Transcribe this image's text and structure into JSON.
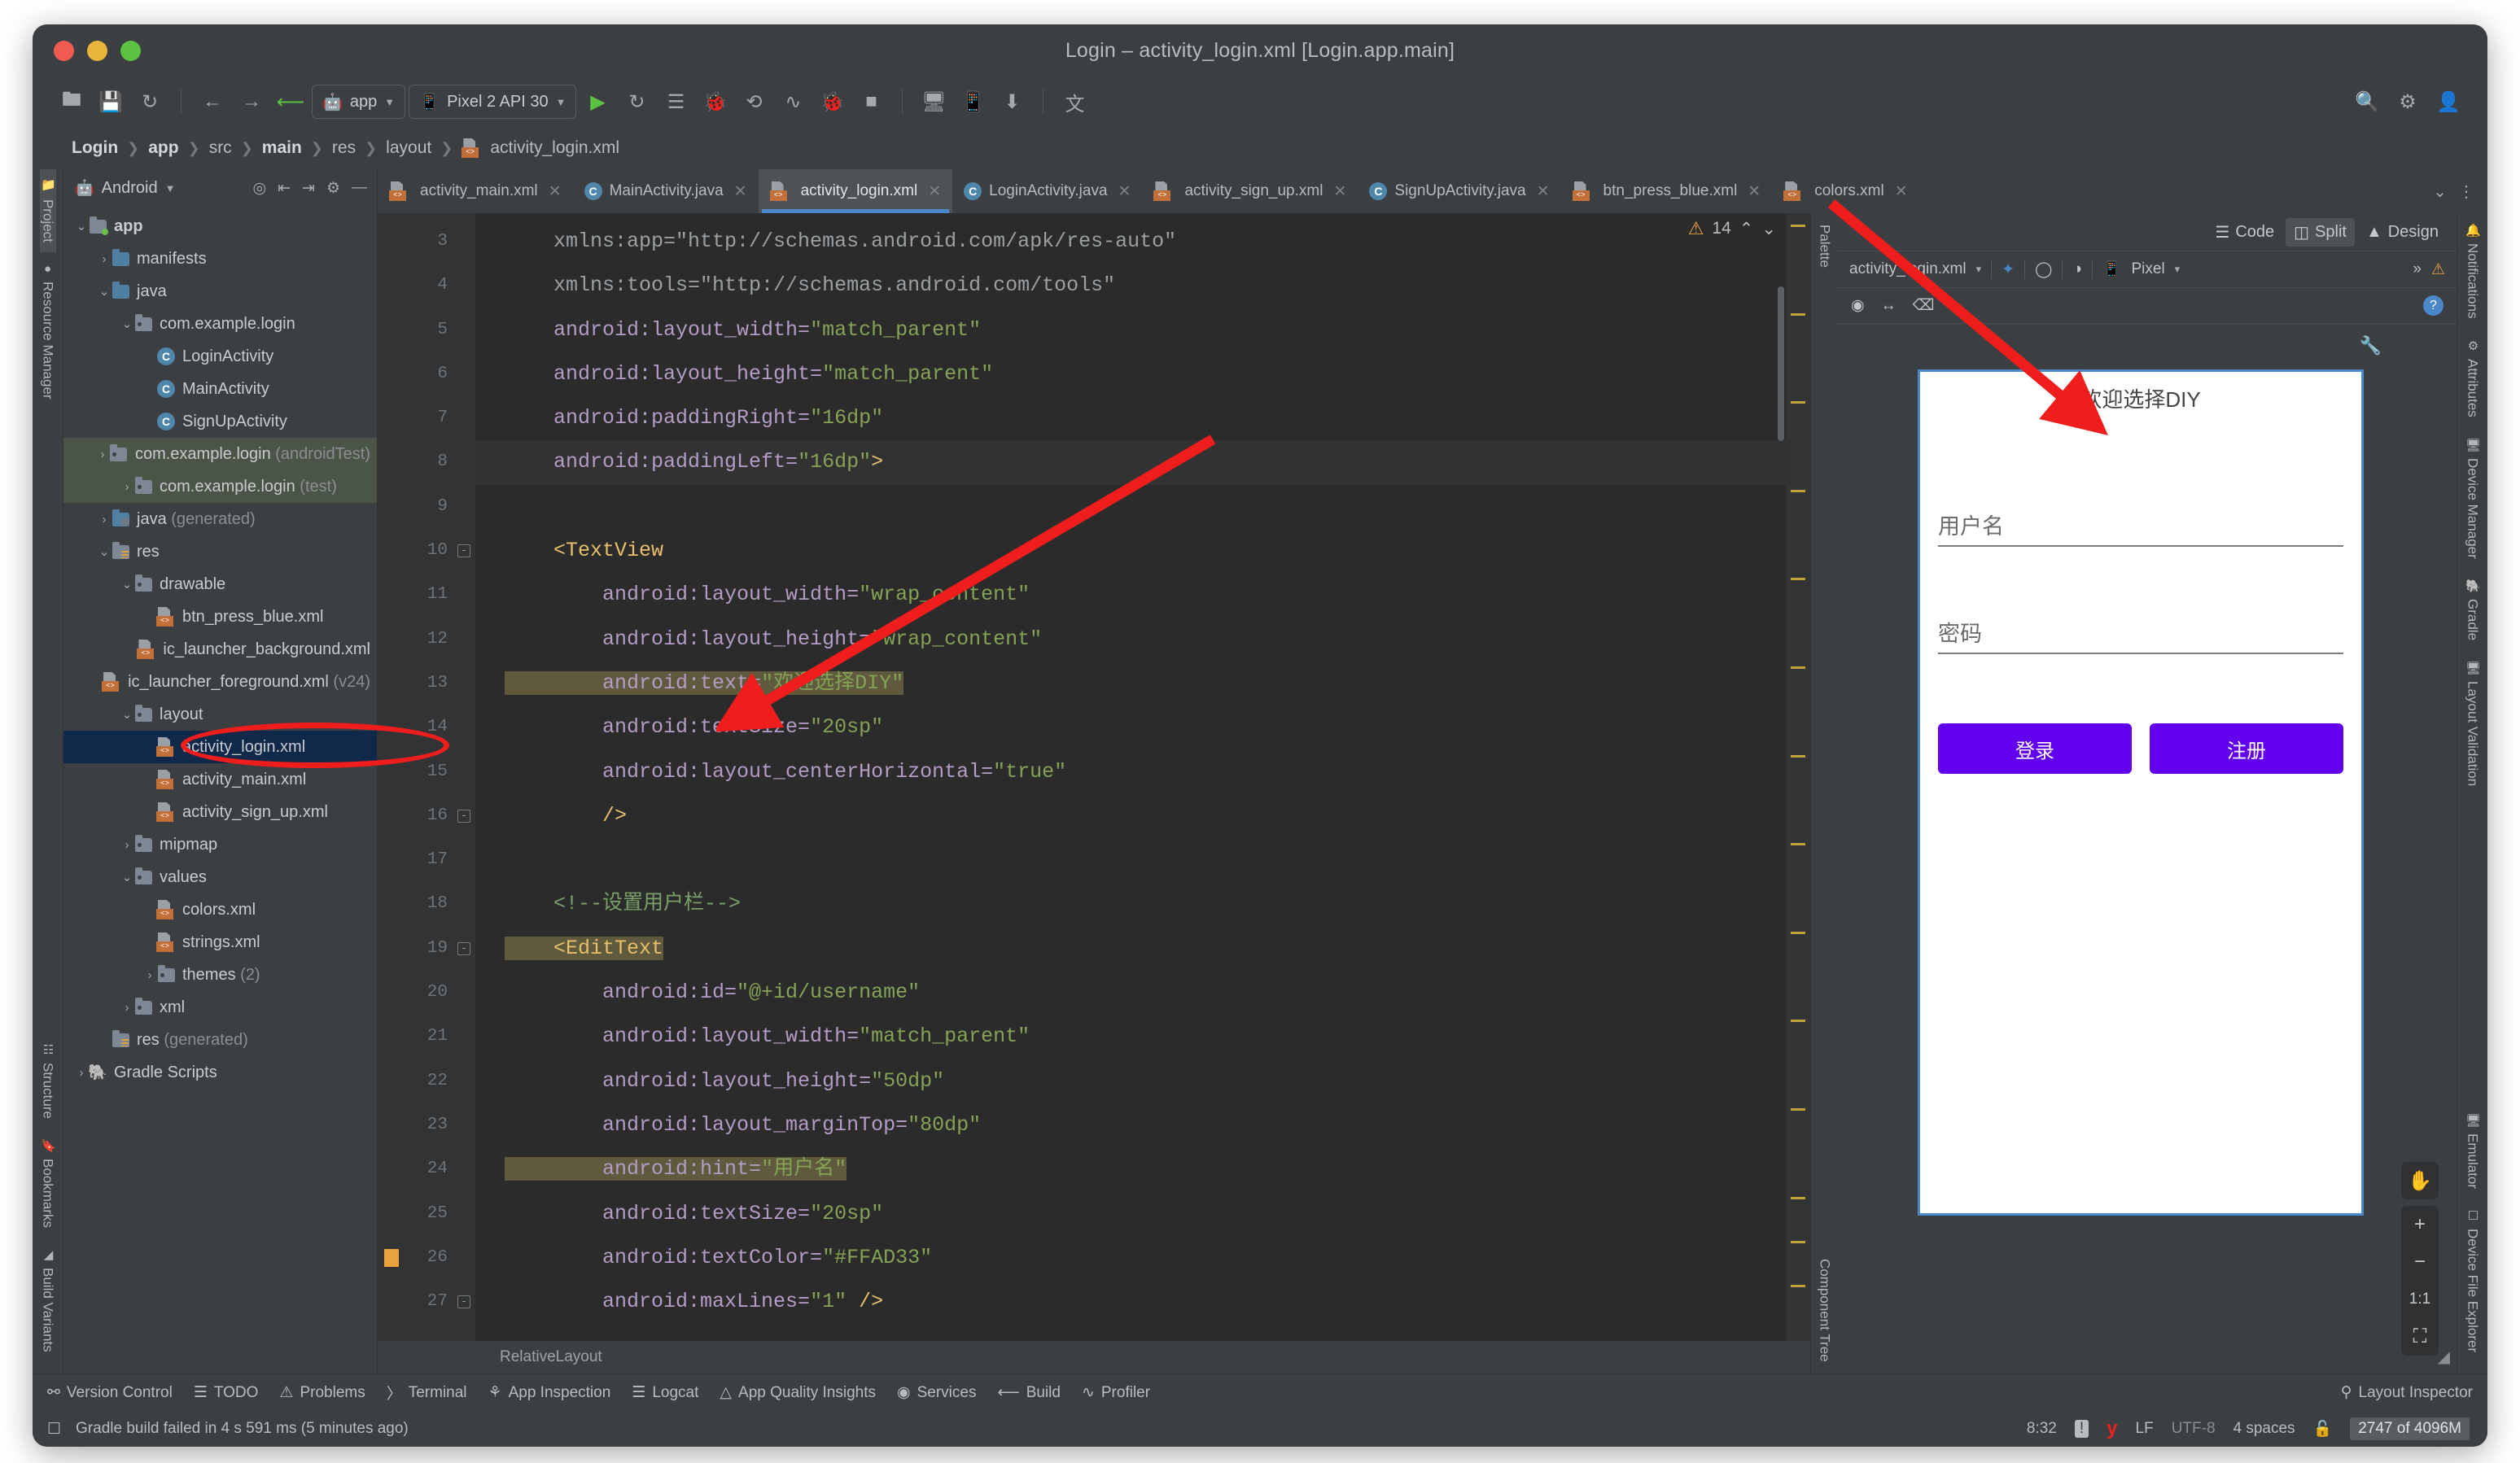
{
  "window": {
    "title": "Login – activity_login.xml [Login.app.main]",
    "traffic": {
      "close": "close-button",
      "minimize": "minimize-button",
      "zoom": "zoom-button"
    }
  },
  "toolbar": {
    "module_chip": "app",
    "device_chip": "Pixel 2 API 30",
    "icons": [
      "open-folder",
      "save",
      "sync",
      "back",
      "forward",
      "build-hammer",
      "run",
      "rerun",
      "more-run",
      "debug",
      "step",
      "profile",
      "attach-debugger",
      "stop",
      "avd-manager",
      "sdk-manager",
      "download",
      "translate"
    ],
    "right_icons": [
      "search",
      "settings",
      "account"
    ]
  },
  "breadcrumbs": [
    {
      "label": "Login",
      "bold": true
    },
    {
      "label": "app",
      "bold": true
    },
    {
      "label": "src",
      "bold": false
    },
    {
      "label": "main",
      "bold": true
    },
    {
      "label": "res",
      "bold": false
    },
    {
      "label": "layout",
      "bold": false
    },
    {
      "label": "activity_login.xml",
      "bold": false,
      "icon": "xml-file-icon"
    }
  ],
  "left_rail": {
    "top": [
      "Project",
      "Resource Manager"
    ],
    "bottom": [
      "Build Variants",
      "Bookmarks",
      "Structure"
    ]
  },
  "right_rail": {
    "top": [
      "Notifications",
      "Device Manager",
      "Gradle",
      "Layout Validation"
    ],
    "bottom": [
      "Device File Explorer",
      "Emulator"
    ]
  },
  "project": {
    "header": "Android",
    "header_icon": "android-icon",
    "tool_icons": [
      "locate-icon",
      "expand-all-icon",
      "collapse-all-icon",
      "gear-icon",
      "hide-icon"
    ],
    "tree": [
      {
        "indent": 0,
        "arrow": "down",
        "icon": "module-folder",
        "label": "app",
        "bold": true,
        "suffix": "",
        "state": ""
      },
      {
        "indent": 1,
        "arrow": "right",
        "icon": "folder-blue",
        "label": "manifests",
        "bold": false,
        "suffix": "",
        "state": ""
      },
      {
        "indent": 1,
        "arrow": "down",
        "icon": "folder-blue",
        "label": "java",
        "bold": false,
        "suffix": "",
        "state": ""
      },
      {
        "indent": 2,
        "arrow": "down",
        "icon": "package",
        "label": "com.example.login",
        "bold": false,
        "suffix": "",
        "state": ""
      },
      {
        "indent": 3,
        "arrow": "none",
        "icon": "class",
        "label": "LoginActivity",
        "bold": false,
        "suffix": "",
        "state": ""
      },
      {
        "indent": 3,
        "arrow": "none",
        "icon": "class",
        "label": "MainActivity",
        "bold": false,
        "suffix": "",
        "state": ""
      },
      {
        "indent": 3,
        "arrow": "none",
        "icon": "class",
        "label": "SignUpActivity",
        "bold": false,
        "suffix": "",
        "state": ""
      },
      {
        "indent": 2,
        "arrow": "right",
        "icon": "package",
        "label": "com.example.login",
        "bold": false,
        "suffix": "(androidTest)",
        "state": "sel-green"
      },
      {
        "indent": 2,
        "arrow": "right",
        "icon": "package",
        "label": "com.example.login",
        "bold": false,
        "suffix": "(test)",
        "state": "sel-green"
      },
      {
        "indent": 1,
        "arrow": "right",
        "icon": "folder-gen",
        "label": "java",
        "bold": false,
        "suffix": "(generated)",
        "state": ""
      },
      {
        "indent": 1,
        "arrow": "down",
        "icon": "folder-res",
        "label": "res",
        "bold": false,
        "suffix": "",
        "state": ""
      },
      {
        "indent": 2,
        "arrow": "down",
        "icon": "package",
        "label": "drawable",
        "bold": false,
        "suffix": "",
        "state": ""
      },
      {
        "indent": 3,
        "arrow": "none",
        "icon": "xml-file",
        "label": "btn_press_blue.xml",
        "bold": false,
        "suffix": "",
        "state": ""
      },
      {
        "indent": 3,
        "arrow": "none",
        "icon": "xml-file",
        "label": "ic_launcher_background.xml",
        "bold": false,
        "suffix": "",
        "state": ""
      },
      {
        "indent": 3,
        "arrow": "none",
        "icon": "xml-file",
        "label": "ic_launcher_foreground.xml",
        "bold": false,
        "suffix": "(v24)",
        "state": ""
      },
      {
        "indent": 2,
        "arrow": "down",
        "icon": "package",
        "label": "layout",
        "bold": false,
        "suffix": "",
        "state": ""
      },
      {
        "indent": 3,
        "arrow": "none",
        "icon": "xml-file",
        "label": "activity_login.xml",
        "bold": false,
        "suffix": "",
        "state": "sel-blue"
      },
      {
        "indent": 3,
        "arrow": "none",
        "icon": "xml-file",
        "label": "activity_main.xml",
        "bold": false,
        "suffix": "",
        "state": ""
      },
      {
        "indent": 3,
        "arrow": "none",
        "icon": "xml-file",
        "label": "activity_sign_up.xml",
        "bold": false,
        "suffix": "",
        "state": ""
      },
      {
        "indent": 2,
        "arrow": "right",
        "icon": "package",
        "label": "mipmap",
        "bold": false,
        "suffix": "",
        "state": ""
      },
      {
        "indent": 2,
        "arrow": "down",
        "icon": "package",
        "label": "values",
        "bold": false,
        "suffix": "",
        "state": ""
      },
      {
        "indent": 3,
        "arrow": "none",
        "icon": "xml-file",
        "label": "colors.xml",
        "bold": false,
        "suffix": "",
        "state": ""
      },
      {
        "indent": 3,
        "arrow": "none",
        "icon": "xml-file",
        "label": "strings.xml",
        "bold": false,
        "suffix": "",
        "state": ""
      },
      {
        "indent": 3,
        "arrow": "right",
        "icon": "package",
        "label": "themes",
        "bold": false,
        "suffix": "(2)",
        "state": ""
      },
      {
        "indent": 2,
        "arrow": "right",
        "icon": "package",
        "label": "xml",
        "bold": false,
        "suffix": "",
        "state": ""
      },
      {
        "indent": 1,
        "arrow": "none",
        "icon": "folder-res",
        "label": "res",
        "bold": false,
        "suffix": "(generated)",
        "state": ""
      },
      {
        "indent": 0,
        "arrow": "right",
        "icon": "gradle",
        "label": "Gradle Scripts",
        "bold": false,
        "suffix": "",
        "state": ""
      }
    ]
  },
  "tabs": [
    {
      "label": "activity_main.xml",
      "icon": "xml-file",
      "active": false
    },
    {
      "label": "MainActivity.java",
      "icon": "class",
      "active": false
    },
    {
      "label": "activity_login.xml",
      "icon": "xml-file",
      "active": true
    },
    {
      "label": "LoginActivity.java",
      "icon": "class",
      "active": false
    },
    {
      "label": "activity_sign_up.xml",
      "icon": "xml-file",
      "active": false
    },
    {
      "label": "SignUpActivity.java",
      "icon": "class",
      "active": false
    },
    {
      "label": "btn_press_blue.xml",
      "icon": "xml-file",
      "active": false
    },
    {
      "label": "colors.xml",
      "icon": "xml-file",
      "active": false
    }
  ],
  "editor": {
    "inspection_count": "14",
    "component_crumb": "RelativeLayout",
    "lines": [
      {
        "n": "3",
        "cut": true,
        "cursor": false,
        "fold": "",
        "warn": false,
        "spans": [
          {
            "t": "    xmlns:app=\"http://schemas.android.com/apk/res-auto\"",
            "c": "ns"
          }
        ]
      },
      {
        "n": "4",
        "cut": false,
        "cursor": false,
        "fold": "",
        "warn": false,
        "spans": [
          {
            "t": "    xmlns:tools=\"http://schemas.android.com/tools\"",
            "c": "ns"
          }
        ]
      },
      {
        "n": "5",
        "cut": false,
        "cursor": false,
        "fold": "",
        "warn": false,
        "spans": [
          {
            "t": "    android:layout_width=",
            "c": "attr"
          },
          {
            "t": "\"match_parent\"",
            "c": "val"
          }
        ]
      },
      {
        "n": "6",
        "cut": false,
        "cursor": false,
        "fold": "",
        "warn": false,
        "spans": [
          {
            "t": "    android:layout_height=",
            "c": "attr"
          },
          {
            "t": "\"match_parent\"",
            "c": "val"
          }
        ]
      },
      {
        "n": "7",
        "cut": false,
        "cursor": false,
        "fold": "",
        "warn": false,
        "spans": [
          {
            "t": "    android:paddingRight=",
            "c": "attr"
          },
          {
            "t": "\"16dp\"",
            "c": "val"
          }
        ]
      },
      {
        "n": "8",
        "cut": false,
        "cursor": true,
        "fold": "",
        "warn": false,
        "spans": [
          {
            "t": "    android:paddingLeft=",
            "c": "attr"
          },
          {
            "t": "\"16dp\"",
            "c": "val"
          },
          {
            "t": ">",
            "c": "tag"
          }
        ]
      },
      {
        "n": "9",
        "cut": false,
        "cursor": false,
        "fold": "",
        "warn": false,
        "spans": []
      },
      {
        "n": "10",
        "cut": false,
        "cursor": false,
        "fold": "-",
        "warn": false,
        "spans": [
          {
            "t": "    <TextView",
            "c": "tag"
          }
        ]
      },
      {
        "n": "11",
        "cut": false,
        "cursor": false,
        "fold": "",
        "warn": false,
        "spans": [
          {
            "t": "        android:layout_width=",
            "c": "attr"
          },
          {
            "t": "\"wrap_content\"",
            "c": "val"
          }
        ]
      },
      {
        "n": "12",
        "cut": false,
        "cursor": false,
        "fold": "",
        "warn": false,
        "spans": [
          {
            "t": "        android:layout_height=",
            "c": "attr"
          },
          {
            "t": "\"wrap_content\"",
            "c": "val"
          }
        ]
      },
      {
        "n": "13",
        "cut": false,
        "cursor": false,
        "fold": "",
        "warn": false,
        "spans": [
          {
            "t": "        android:text=",
            "c": "attr hl"
          },
          {
            "t": "\"欢迎选择DIY\"",
            "c": "val hl"
          }
        ]
      },
      {
        "n": "14",
        "cut": false,
        "cursor": false,
        "fold": "",
        "warn": false,
        "spans": [
          {
            "t": "        android:textSize=",
            "c": "attr"
          },
          {
            "t": "\"20sp\"",
            "c": "val"
          }
        ]
      },
      {
        "n": "15",
        "cut": false,
        "cursor": false,
        "fold": "",
        "warn": false,
        "spans": [
          {
            "t": "        android:layout_centerHorizontal=",
            "c": "attr"
          },
          {
            "t": "\"true\"",
            "c": "val"
          }
        ]
      },
      {
        "n": "16",
        "cut": false,
        "cursor": false,
        "fold": "-",
        "warn": false,
        "spans": [
          {
            "t": "        />",
            "c": "tag"
          }
        ]
      },
      {
        "n": "17",
        "cut": false,
        "cursor": false,
        "fold": "",
        "warn": false,
        "spans": []
      },
      {
        "n": "18",
        "cut": false,
        "cursor": false,
        "fold": "",
        "warn": false,
        "spans": [
          {
            "t": "    <!--设置用户栏-->",
            "c": "cmt"
          }
        ]
      },
      {
        "n": "19",
        "cut": false,
        "cursor": false,
        "fold": "-",
        "warn": false,
        "spans": [
          {
            "t": "    <EditText",
            "c": "tag hl"
          }
        ]
      },
      {
        "n": "20",
        "cut": false,
        "cursor": false,
        "fold": "",
        "warn": false,
        "spans": [
          {
            "t": "        android:id=",
            "c": "attr"
          },
          {
            "t": "\"@+id/username\"",
            "c": "val"
          }
        ]
      },
      {
        "n": "21",
        "cut": false,
        "cursor": false,
        "fold": "",
        "warn": false,
        "spans": [
          {
            "t": "        android:layout_width=",
            "c": "attr"
          },
          {
            "t": "\"match_parent\"",
            "c": "val"
          }
        ]
      },
      {
        "n": "22",
        "cut": false,
        "cursor": false,
        "fold": "",
        "warn": false,
        "spans": [
          {
            "t": "        android:layout_height=",
            "c": "attr"
          },
          {
            "t": "\"50dp\"",
            "c": "val"
          }
        ]
      },
      {
        "n": "23",
        "cut": false,
        "cursor": false,
        "fold": "",
        "warn": false,
        "spans": [
          {
            "t": "        android:layout_marginTop=",
            "c": "attr"
          },
          {
            "t": "\"80dp\"",
            "c": "val"
          }
        ]
      },
      {
        "n": "24",
        "cut": false,
        "cursor": false,
        "fold": "",
        "warn": false,
        "spans": [
          {
            "t": "        android:hint=",
            "c": "attr hl"
          },
          {
            "t": "\"用户名\"",
            "c": "val hl"
          }
        ]
      },
      {
        "n": "25",
        "cut": false,
        "cursor": false,
        "fold": "",
        "warn": false,
        "spans": [
          {
            "t": "        android:textSize=",
            "c": "attr"
          },
          {
            "t": "\"20sp\"",
            "c": "val"
          }
        ]
      },
      {
        "n": "26",
        "cut": false,
        "cursor": false,
        "fold": "",
        "warn": true,
        "spans": [
          {
            "t": "        android:textColor=",
            "c": "attr"
          },
          {
            "t": "\"#FFAD33\"",
            "c": "val"
          }
        ]
      },
      {
        "n": "27",
        "cut": false,
        "cursor": false,
        "fold": "-",
        "warn": false,
        "spans": [
          {
            "t": "        android:maxLines=",
            "c": "attr"
          },
          {
            "t": "\"1\"",
            "c": "val"
          },
          {
            "t": " />",
            "c": "tag"
          }
        ]
      }
    ]
  },
  "design": {
    "modes": [
      {
        "label": "Code",
        "icon": "code-lines-icon",
        "active": false
      },
      {
        "label": "Split",
        "icon": "split-icon",
        "active": true
      },
      {
        "label": "Design",
        "icon": "design-icon",
        "active": false
      }
    ],
    "file_selector": "activity_login.xml",
    "device_selector": "Pixel",
    "toolbar_icons": [
      "layers-icon",
      "orientation-icon",
      "theme-icon",
      "device-icon",
      "overflow-icon",
      "warning-icon"
    ],
    "row2_icons": [
      "eye-icon",
      "width-icon",
      "magnet-off-icon"
    ],
    "help_label": "?",
    "palette_label": "Palette",
    "attributes_label": "Attributes",
    "component_tree_label": "Component Tree",
    "zoom_controls": {
      "pan": "pan-hand-icon",
      "zoom_in": "+",
      "zoom_out": "−",
      "reset": "1:1",
      "fit": "fit-icon"
    },
    "preview": {
      "title": "欢迎选择DIY",
      "username_hint": "用户名",
      "password_hint": "密码",
      "login_button": "登录",
      "signup_button": "注册",
      "button_color": "#6200EE"
    }
  },
  "bottom_tools": [
    {
      "label": "Version Control",
      "icon": "branch-icon"
    },
    {
      "label": "TODO",
      "icon": "list-icon"
    },
    {
      "label": "Problems",
      "icon": "problems-icon"
    },
    {
      "label": "Terminal",
      "icon": "terminal-icon"
    },
    {
      "label": "App Inspection",
      "icon": "inspection-icon"
    },
    {
      "label": "Logcat",
      "icon": "logcat-icon"
    },
    {
      "label": "App Quality Insights",
      "icon": "insights-icon"
    },
    {
      "label": "Services",
      "icon": "services-icon"
    },
    {
      "label": "Build",
      "icon": "build-icon"
    },
    {
      "label": "Profiler",
      "icon": "profiler-icon"
    }
  ],
  "bottom_right_tool": {
    "label": "Layout Inspector",
    "icon": "layout-inspector-icon"
  },
  "status": {
    "message": "Gradle build failed in 4 s 591 ms (5 minutes ago)",
    "caret": "8:32",
    "line_ending": "LF",
    "encoding": "UTF-8",
    "indent": "4 spaces",
    "memory": "2747 of 4096M",
    "lock_icon": "unlocked-icon",
    "yandex_icon": "y-icon",
    "notify_icon": "message-icon"
  },
  "annotations": {
    "arrow_color": "#f01d1d",
    "highlight_target": "activity_login.xml"
  }
}
